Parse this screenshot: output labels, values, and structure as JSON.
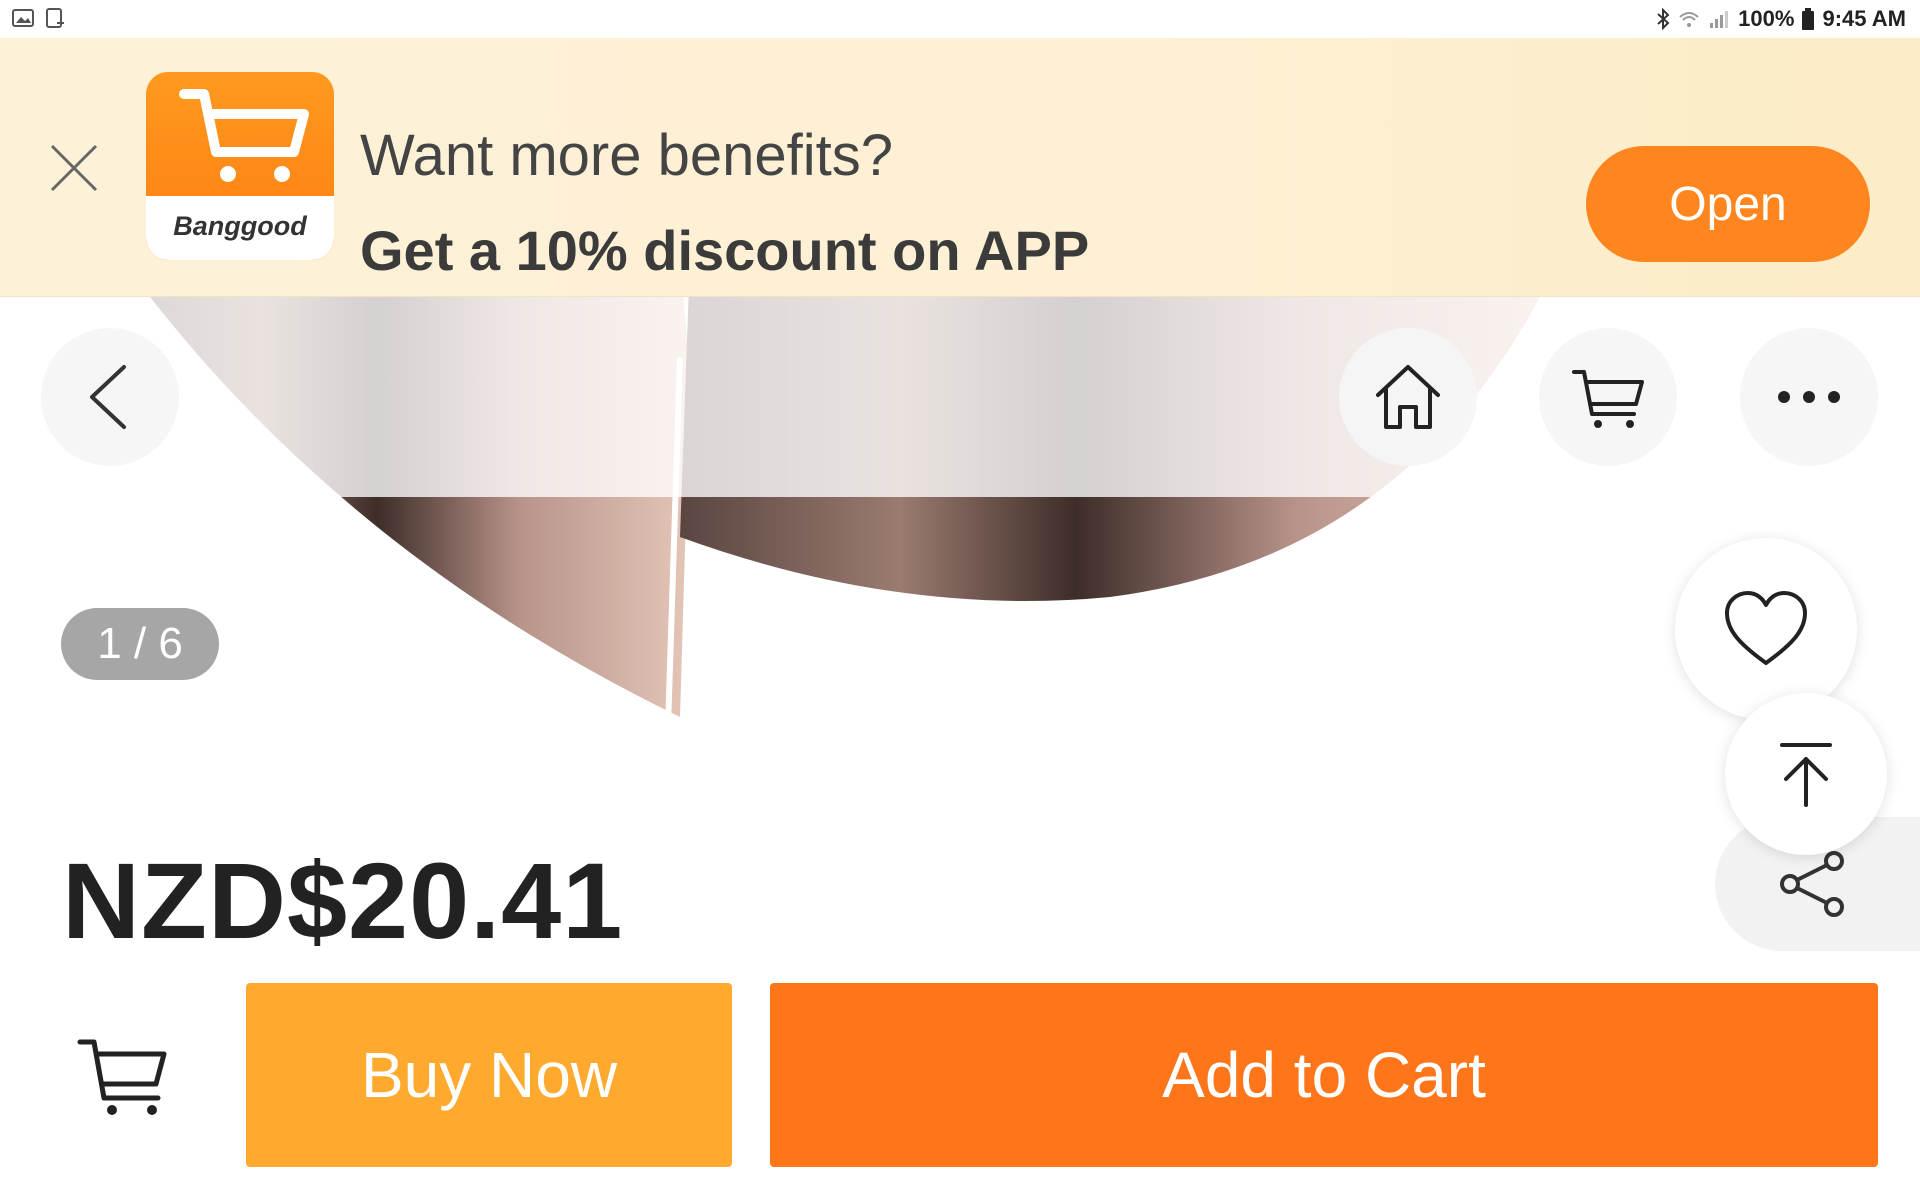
{
  "status_bar": {
    "left_icons": [
      "gallery-icon",
      "device-icon"
    ],
    "right_icons": [
      "bluetooth-icon",
      "wifi-icon",
      "signal-icon",
      "battery-icon"
    ],
    "battery": "100%",
    "time": "9:45 AM"
  },
  "banner": {
    "logo_text": "Banggood",
    "title": "Want more benefits?",
    "subtitle": "Get a 10% discount on APP",
    "open_label": "Open"
  },
  "nav": {
    "back_icon": "chevron-left-icon",
    "home_icon": "home-icon",
    "cart_icon": "cart-icon",
    "more_icon": "more-dots-icon"
  },
  "gallery": {
    "counter": "1 / 6"
  },
  "floating": {
    "wishlist_icon": "heart-icon",
    "top_icon": "back-to-top-icon",
    "share_icon": "share-icon"
  },
  "product": {
    "price": "NZD$20.41"
  },
  "actions": {
    "cart_icon": "cart-icon",
    "buy_now": "Buy Now",
    "add_to_cart": "Add to Cart"
  },
  "colors": {
    "accent_orange": "#ff7519",
    "buy_now_orange": "#ffaa2f",
    "banner_bg": "#fdf1d8",
    "counter_bg": "#a6a6a6"
  }
}
